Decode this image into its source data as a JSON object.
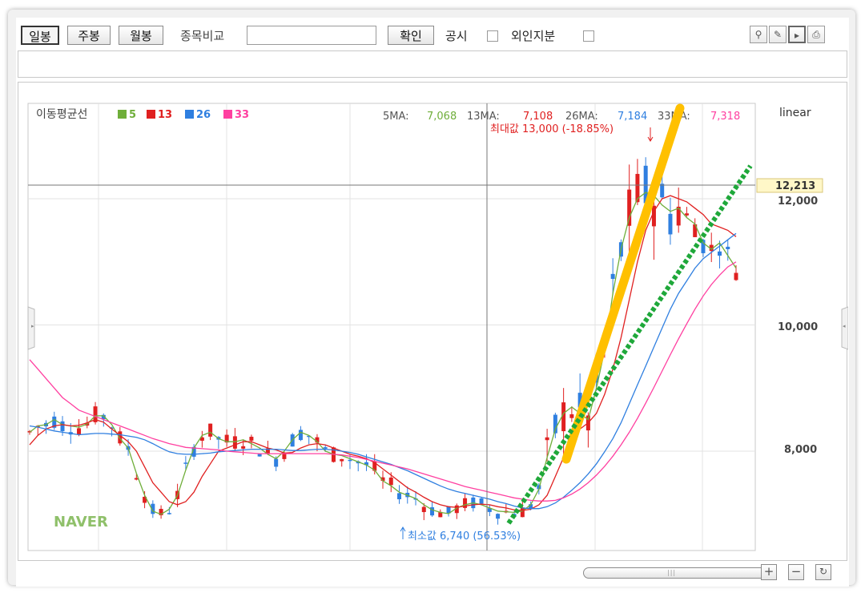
{
  "toolbar": {
    "period_daily": "일봉",
    "period_weekly": "주봉",
    "period_monthly": "월봉",
    "compare_label": "종목비교",
    "compare_value": "",
    "confirm_label": "확인",
    "disclosure_label": "공시",
    "foreign_label": "외인지분",
    "tool_icons": [
      "pin-icon",
      "eraser-icon",
      "cursor-icon",
      "print-icon"
    ]
  },
  "legend": {
    "title": "이동평균선",
    "ma": [
      {
        "label": "5",
        "color": "#6fae3a"
      },
      {
        "label": "13",
        "color": "#e02020"
      },
      {
        "label": "26",
        "color": "#2f7fe0"
      },
      {
        "label": "33",
        "color": "#ff3fa0"
      }
    ],
    "values": [
      {
        "name": "5MA:",
        "value": "7,068",
        "color": "#6fae3a"
      },
      {
        "name": "13MA:",
        "value": "7,108",
        "color": "#e02020"
      },
      {
        "name": "26MA:",
        "value": "7,184",
        "color": "#2f7fe0"
      },
      {
        "name": "33MA:",
        "value": "7,318",
        "color": "#ff3fa0"
      }
    ],
    "scale": "linear"
  },
  "annotations": {
    "max_label": "최대값 13,000 (-18.85%)",
    "min_label": "최소값 6,740 (56.53%)",
    "crosshair_value": "12,213",
    "watermark": "NAVER"
  },
  "colors": {
    "up": "#e02020",
    "down": "#2f7fe0",
    "trend_yellow": "#ffc000",
    "trend_green": "#1fa83a"
  },
  "chart_data": {
    "type": "line",
    "title": "",
    "yaxis_ticks": [
      "8,000",
      "10,000",
      "12,000"
    ],
    "ylim": [
      6640,
      13300
    ],
    "series": [
      {
        "name": "5",
        "values": [
          8300,
          8400,
          8420,
          8500,
          8420,
          8400,
          8380,
          8430,
          8560,
          8560,
          8420,
          8200,
          8050,
          7650,
          7300,
          7050,
          7000,
          7080,
          7300,
          7700,
          8050,
          8250,
          8300,
          8200,
          8150,
          8150,
          8180,
          8120,
          8050,
          7950,
          7880,
          8000,
          8180,
          8300,
          8250,
          8150,
          8000,
          7950,
          7930,
          7880,
          7830,
          7780,
          7700,
          7530,
          7450,
          7350,
          7300,
          7250,
          7150,
          7070,
          7030,
          7010,
          7100,
          7150,
          7180,
          7150,
          7100,
          7050,
          7040,
          7030,
          7050,
          7150,
          7400,
          7900,
          8350,
          8600,
          8700,
          8600,
          8500,
          9000,
          9600,
          10500,
          11200,
          11700,
          12000,
          12100,
          12050,
          11900,
          11800,
          11850,
          11700,
          11600,
          11300,
          11200,
          11300,
          11100,
          10900
        ]
      },
      {
        "name": "13",
        "values": [
          8100,
          8250,
          8350,
          8400,
          8420,
          8400,
          8410,
          8450,
          8500,
          8460,
          8350,
          8250,
          8150,
          8000,
          7750,
          7500,
          7350,
          7200,
          7150,
          7200,
          7350,
          7600,
          7800,
          8000,
          8050,
          8100,
          8150,
          8150,
          8100,
          8050,
          8020,
          7970,
          7980,
          8050,
          8100,
          8120,
          8100,
          8050,
          8000,
          7950,
          7920,
          7880,
          7820,
          7720,
          7620,
          7520,
          7420,
          7350,
          7270,
          7200,
          7150,
          7120,
          7110,
          7130,
          7150,
          7160,
          7150,
          7120,
          7100,
          7070,
          7060,
          7080,
          7150,
          7300,
          7600,
          7900,
          8150,
          8350,
          8450,
          8600,
          8900,
          9300,
          9800,
          10400,
          11000,
          11500,
          11800,
          12000,
          12050,
          12000,
          11950,
          11850,
          11750,
          11600,
          11550,
          11500,
          11400
        ]
      },
      {
        "name": "26",
        "values": [
          8400,
          8380,
          8350,
          8320,
          8300,
          8280,
          8260,
          8270,
          8280,
          8280,
          8270,
          8260,
          8240,
          8220,
          8180,
          8120,
          8050,
          7990,
          7960,
          7950,
          7950,
          7960,
          7970,
          7990,
          8000,
          8010,
          8020,
          8030,
          8030,
          8030,
          8030,
          8020,
          8010,
          8010,
          8020,
          8030,
          8030,
          8020,
          8000,
          7980,
          7950,
          7910,
          7870,
          7830,
          7790,
          7740,
          7690,
          7630,
          7570,
          7510,
          7450,
          7400,
          7360,
          7330,
          7300,
          7270,
          7240,
          7200,
          7170,
          7130,
          7100,
          7090,
          7090,
          7120,
          7180,
          7270,
          7380,
          7500,
          7640,
          7800,
          7990,
          8200,
          8450,
          8750,
          9050,
          9350,
          9650,
          9950,
          10250,
          10500,
          10700,
          10900,
          11050,
          11150,
          11250,
          11350,
          11450
        ]
      },
      {
        "name": "33",
        "values": [
          9450,
          9300,
          9150,
          9000,
          8850,
          8750,
          8650,
          8600,
          8550,
          8500,
          8450,
          8400,
          8350,
          8300,
          8250,
          8200,
          8160,
          8120,
          8090,
          8060,
          8050,
          8040,
          8030,
          8020,
          8000,
          7990,
          7980,
          7970,
          7960,
          7960,
          7960,
          7960,
          7960,
          7960,
          7960,
          7960,
          7960,
          7950,
          7940,
          7920,
          7900,
          7870,
          7840,
          7810,
          7780,
          7750,
          7720,
          7680,
          7640,
          7600,
          7560,
          7520,
          7480,
          7440,
          7410,
          7380,
          7350,
          7320,
          7290,
          7260,
          7240,
          7220,
          7210,
          7210,
          7220,
          7260,
          7320,
          7400,
          7500,
          7620,
          7760,
          7920,
          8100,
          8300,
          8520,
          8760,
          9010,
          9270,
          9530,
          9780,
          10020,
          10250,
          10460,
          10640,
          10790,
          10920,
          11000
        ]
      }
    ]
  }
}
